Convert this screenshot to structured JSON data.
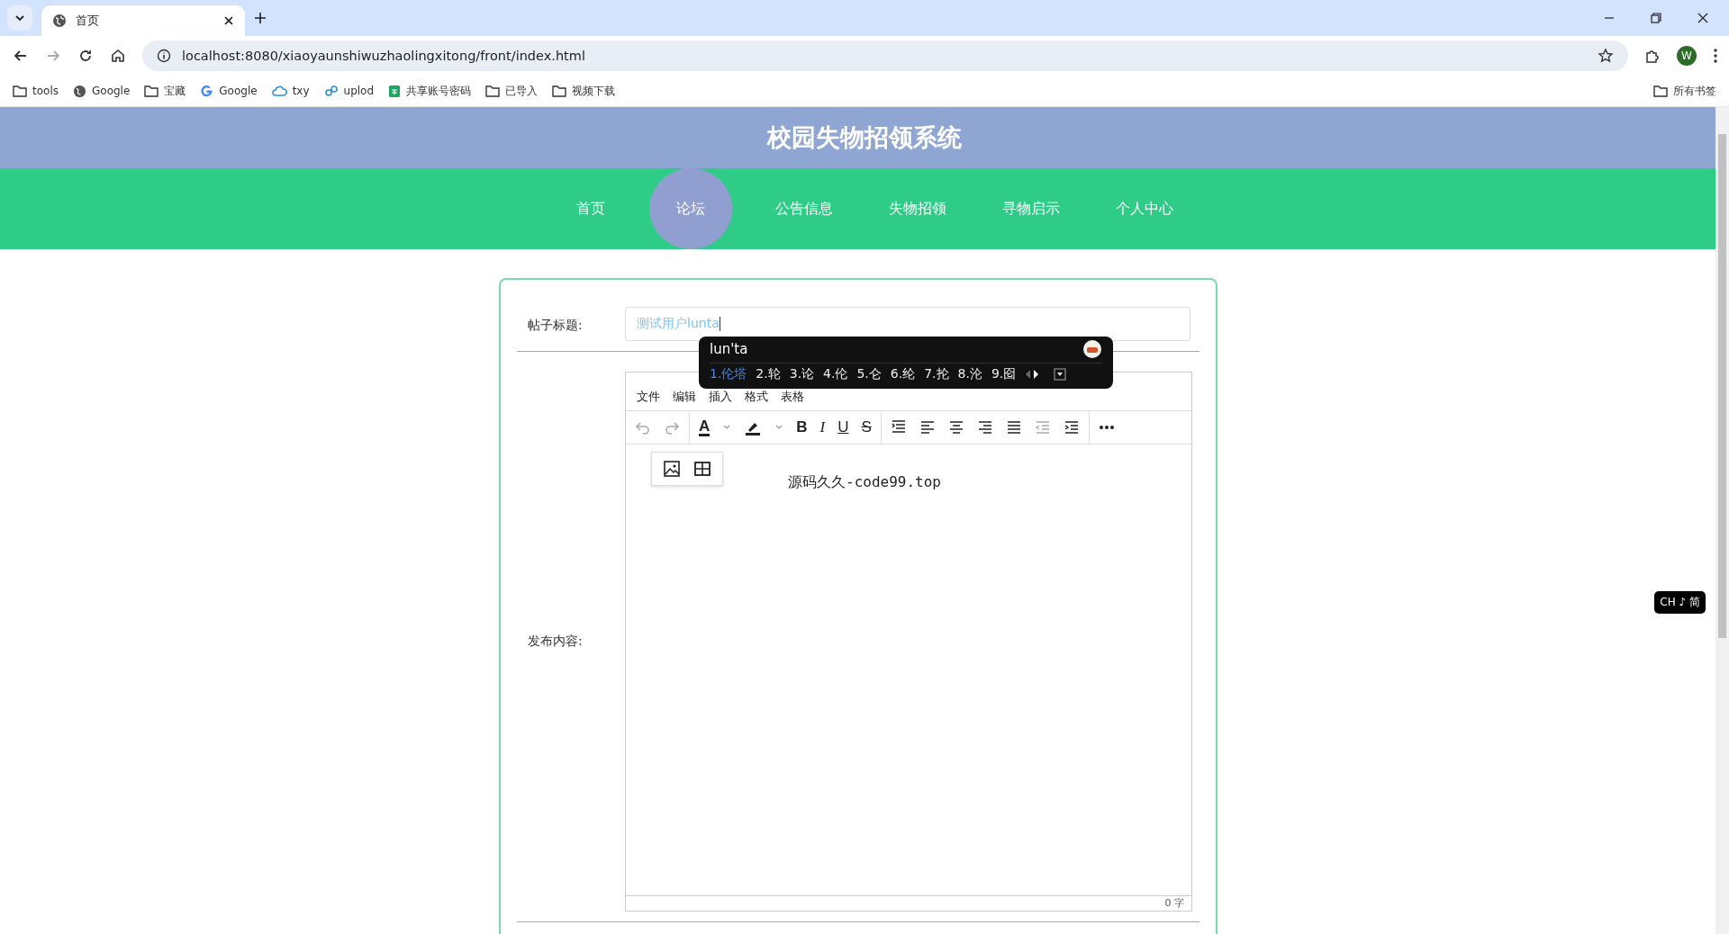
{
  "browser": {
    "tab_title": "首页",
    "url": "localhost:8080/xiaoyaunshiwuzhaolingxitong/front/index.html",
    "avatar": "W",
    "bookmarks": [
      {
        "label": "tools",
        "kind": "folder"
      },
      {
        "label": "Google",
        "kind": "globe"
      },
      {
        "label": "宝藏",
        "kind": "folder"
      },
      {
        "label": "Google",
        "kind": "google"
      },
      {
        "label": "txy",
        "kind": "cloud"
      },
      {
        "label": "uplod",
        "kind": "link"
      },
      {
        "label": "共享账号密码",
        "kind": "sheet"
      },
      {
        "label": "已导入",
        "kind": "folder"
      },
      {
        "label": "视频下载",
        "kind": "folder"
      }
    ],
    "all_bookmarks": "所有书签"
  },
  "site_title": "校园失物招领系统",
  "nav": [
    {
      "label": "首页",
      "selected": false
    },
    {
      "label": "论坛",
      "selected": true
    },
    {
      "label": "公告信息",
      "selected": false
    },
    {
      "label": "失物招领",
      "selected": false
    },
    {
      "label": "寻物启示",
      "selected": false
    },
    {
      "label": "个人中心",
      "selected": false
    }
  ],
  "form": {
    "title_label": "帖子标题:",
    "title_value": "测试用户lunta",
    "content_label": "发布内容:",
    "editor": {
      "menus": [
        "文件",
        "编辑",
        "插入",
        "格式",
        "表格"
      ],
      "toolbar": {
        "font_color": "A",
        "bold": "B",
        "italic": "I",
        "underline": "U",
        "strike": "S"
      },
      "content": "源码久久-code99.top",
      "word_count": "0 字"
    }
  },
  "ime": {
    "composition": "lun'ta",
    "candidates": [
      {
        "text": "1.伦塔",
        "selected": true
      },
      {
        "text": "2.轮",
        "selected": false
      },
      {
        "text": "3.论",
        "selected": false
      },
      {
        "text": "4.伦",
        "selected": false
      },
      {
        "text": "5.仑",
        "selected": false
      },
      {
        "text": "6.纶",
        "selected": false
      },
      {
        "text": "7.抡",
        "selected": false
      },
      {
        "text": "8.沦",
        "selected": false
      },
      {
        "text": "9.囵",
        "selected": false
      }
    ],
    "mode_indicator": "CH ♪ 简"
  }
}
